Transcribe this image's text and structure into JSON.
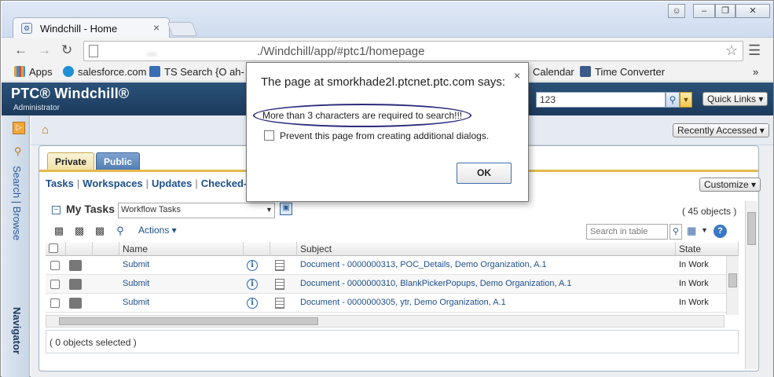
{
  "browser": {
    "tab_title": "Windchill - Home",
    "tab_close": "×",
    "url_blurred": "...",
    "url": "./Windchill/app/#ptc1/homepage",
    "bookmarks": [
      {
        "label": "Apps",
        "color": "#e0a03a"
      },
      {
        "label": "salesforce.com",
        "color": "#1f8fd6"
      },
      {
        "label": "TS Search",
        "color": "#3a6fb5"
      },
      {
        "label": "{O ah-",
        "color": "#ffffff"
      },
      {
        "label": "Calendar",
        "color": "#ffffff"
      },
      {
        "label": "Time Converter",
        "color": "#3a5a8a"
      }
    ],
    "bookmarks_more": "»"
  },
  "header": {
    "logo": "PTC® Windchill®",
    "role": "Administrator",
    "search_value": "123",
    "quick_links": "Quick Links ▾"
  },
  "leftnav": {
    "search_browse": "Search | Browse",
    "navigator": "Navigator"
  },
  "home": {
    "recently_accessed": "Recently Accessed ▾",
    "tabs": [
      "Private",
      "Public"
    ],
    "links": [
      "Tasks",
      "Workspaces",
      "Updates",
      "Checked-Out W"
    ],
    "customize": "Customize ▾"
  },
  "mytasks": {
    "title": "My Tasks",
    "selected_view": "Workflow Tasks",
    "count": "( 45 objects )",
    "actions_label": "Actions ▾",
    "search_placeholder": "Search in table",
    "columns": [
      "Name",
      "Subject",
      "State"
    ],
    "rows": [
      {
        "name": "Submit",
        "subject": "Document - 0000000313, POC_Details, Demo Organization, A.1",
        "state": "In Work"
      },
      {
        "name": "Submit",
        "subject": "Document - 0000000310, BlankPickerPopups, Demo Organization, A.1",
        "state": "In Work"
      },
      {
        "name": "Submit",
        "subject": "Document - 0000000305, ytr, Demo Organization, A.1",
        "state": "In Work"
      }
    ],
    "selected_status": "( 0 objects selected )"
  },
  "dialog": {
    "title": "The page at smorkhade2l.ptcnet.ptc.com says:",
    "message": "More than 3 characters are required to search!!!",
    "checkbox_label": "Prevent this page from creating additional dialogs.",
    "ok": "OK",
    "close": "×"
  },
  "colors": {
    "header_bg": "#1b3a5c",
    "link": "#1d4f8c",
    "tab_active": "#f0e1a4",
    "tab_inactive": "#4f7cb2",
    "highlight_oval": "#2a2d7a"
  }
}
